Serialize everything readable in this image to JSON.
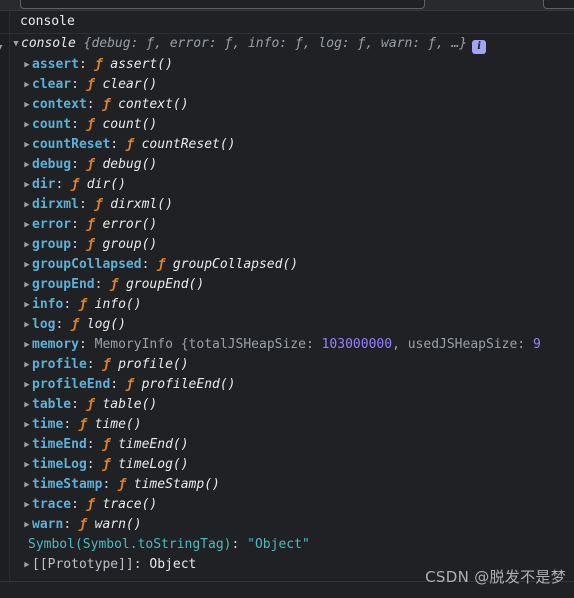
{
  "toolbar": {
    "filter_placeholder": "",
    "filter_value": ""
  },
  "console": {
    "input_echo": "console",
    "result_header": {
      "object_name": "console",
      "preview": "{debug: ƒ, error: ƒ, info: ƒ, log: ƒ, warn: ƒ, …}",
      "info_icon_label": "i",
      "expand_arrow": "▼"
    },
    "properties": [
      {
        "arrow": "▶",
        "name": "assert",
        "colon": ":",
        "fmark": "ƒ",
        "sig": "assert()"
      },
      {
        "arrow": "▶",
        "name": "clear",
        "colon": ":",
        "fmark": "ƒ",
        "sig": "clear()"
      },
      {
        "arrow": "▶",
        "name": "context",
        "colon": ":",
        "fmark": "ƒ",
        "sig": "context()"
      },
      {
        "arrow": "▶",
        "name": "count",
        "colon": ":",
        "fmark": "ƒ",
        "sig": "count()"
      },
      {
        "arrow": "▶",
        "name": "countReset",
        "colon": ":",
        "fmark": "ƒ",
        "sig": "countReset()"
      },
      {
        "arrow": "▶",
        "name": "debug",
        "colon": ":",
        "fmark": "ƒ",
        "sig": "debug()"
      },
      {
        "arrow": "▶",
        "name": "dir",
        "colon": ":",
        "fmark": "ƒ",
        "sig": "dir()"
      },
      {
        "arrow": "▶",
        "name": "dirxml",
        "colon": ":",
        "fmark": "ƒ",
        "sig": "dirxml()"
      },
      {
        "arrow": "▶",
        "name": "error",
        "colon": ":",
        "fmark": "ƒ",
        "sig": "error()"
      },
      {
        "arrow": "▶",
        "name": "group",
        "colon": ":",
        "fmark": "ƒ",
        "sig": "group()"
      },
      {
        "arrow": "▶",
        "name": "groupCollapsed",
        "colon": ":",
        "fmark": "ƒ",
        "sig": "groupCollapsed()"
      },
      {
        "arrow": "▶",
        "name": "groupEnd",
        "colon": ":",
        "fmark": "ƒ",
        "sig": "groupEnd()"
      },
      {
        "arrow": "▶",
        "name": "info",
        "colon": ":",
        "fmark": "ƒ",
        "sig": "info()"
      },
      {
        "arrow": "▶",
        "name": "log",
        "colon": ":",
        "fmark": "ƒ",
        "sig": "log()"
      }
    ],
    "memory_row": {
      "arrow": "▶",
      "name": "memory",
      "colon": ":",
      "ctor": "MemoryInfo {",
      "key1": "totalJSHeapSize:",
      "val1": "103000000",
      "comma": ",",
      "key2": "usedJSHeapSize:",
      "val2_truncated": "9"
    },
    "properties2": [
      {
        "arrow": "▶",
        "name": "profile",
        "colon": ":",
        "fmark": "ƒ",
        "sig": "profile()"
      },
      {
        "arrow": "▶",
        "name": "profileEnd",
        "colon": ":",
        "fmark": "ƒ",
        "sig": "profileEnd()"
      },
      {
        "arrow": "▶",
        "name": "table",
        "colon": ":",
        "fmark": "ƒ",
        "sig": "table()"
      },
      {
        "arrow": "▶",
        "name": "time",
        "colon": ":",
        "fmark": "ƒ",
        "sig": "time()"
      },
      {
        "arrow": "▶",
        "name": "timeEnd",
        "colon": ":",
        "fmark": "ƒ",
        "sig": "timeEnd()"
      },
      {
        "arrow": "▶",
        "name": "timeLog",
        "colon": ":",
        "fmark": "ƒ",
        "sig": "timeLog()"
      },
      {
        "arrow": "▶",
        "name": "timeStamp",
        "colon": ":",
        "fmark": "ƒ",
        "sig": "timeStamp()"
      },
      {
        "arrow": "▶",
        "name": "trace",
        "colon": ":",
        "fmark": "ƒ",
        "sig": "trace()"
      },
      {
        "arrow": "▶",
        "name": "warn",
        "colon": ":",
        "fmark": "ƒ",
        "sig": "warn()"
      }
    ],
    "symbol_row": {
      "key": "Symbol(Symbol.toStringTag)",
      "colon": ":",
      "value": "\"Object\""
    },
    "prototype_row": {
      "arrow": "▶",
      "key": "[[Prototype]]",
      "colon": ":",
      "value": "Object"
    }
  },
  "watermark": {
    "text": "CSDN @脱发不是梦"
  },
  "colors": {
    "background": "#202124",
    "property_name": "#5db0d7",
    "function_mark": "#e0802c",
    "number": "#9980ff",
    "string": "#4dbbbb",
    "preview_gray": "#9aa0a6",
    "info_badge": "#a6a2f5"
  }
}
